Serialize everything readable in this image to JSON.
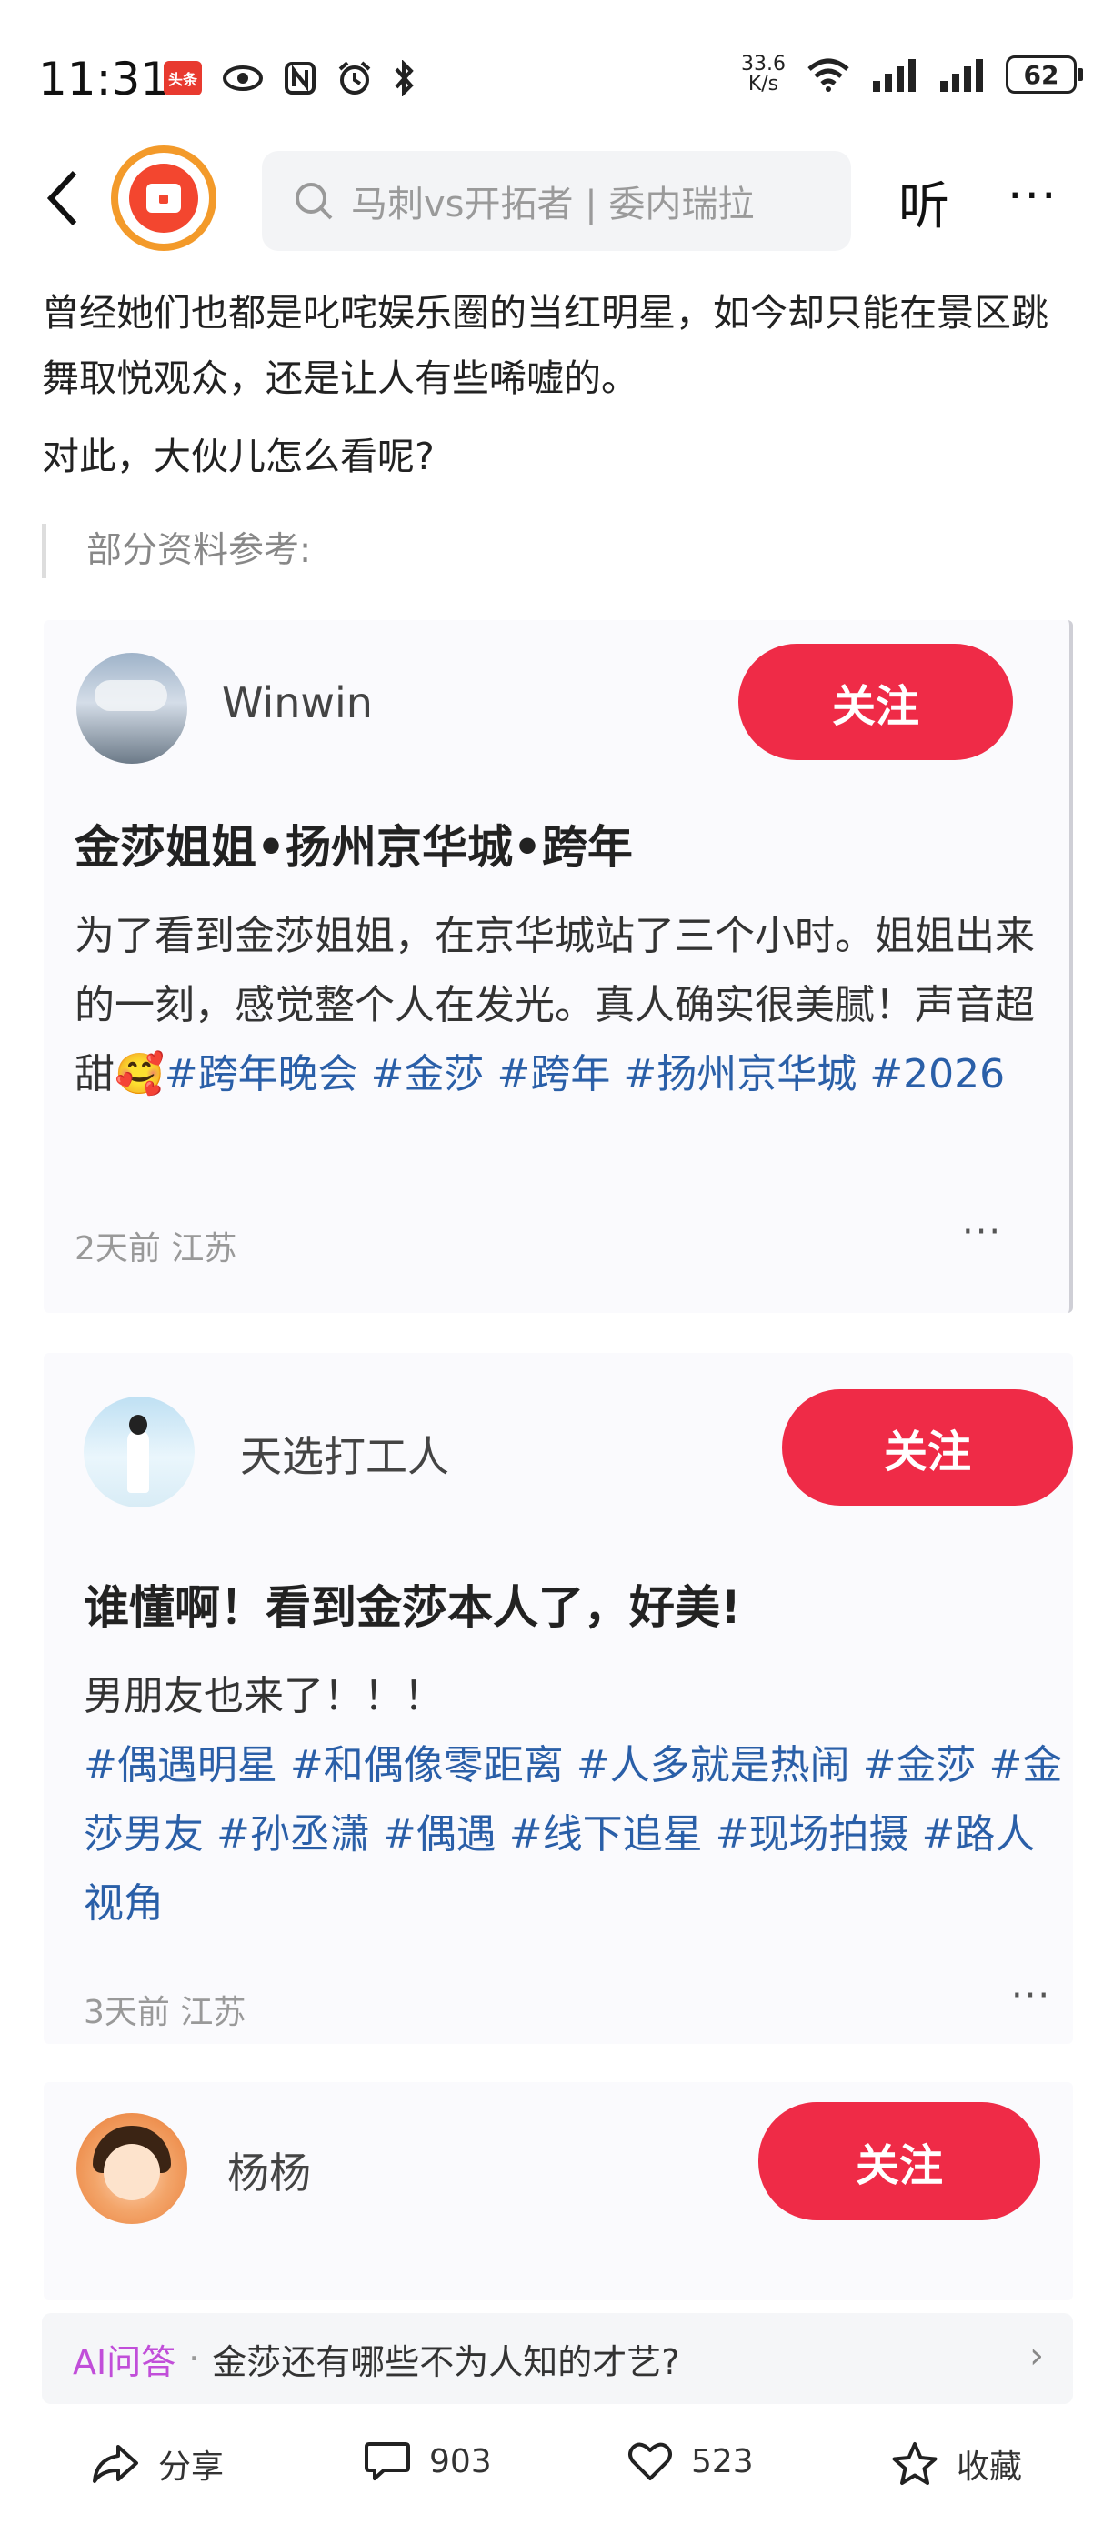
{
  "status_bar": {
    "time": "11:31",
    "news_badge": "头条",
    "net_speed_value": "33.6",
    "net_speed_unit": "K/s",
    "battery": "62"
  },
  "nav": {
    "search_placeholder": "马刺vs开拓者 | 委内瑞拉",
    "listen_label": "听",
    "more_label": "···"
  },
  "article": {
    "paragraph_1": "曾经她们也都是叱咤娱乐圈的当红明星，如今却只能在景区跳舞取悦观众，还是让人有些唏嘘的。",
    "paragraph_2": "对此，大伙儿怎么看呢?",
    "reference_label": "部分资料参考:"
  },
  "posts": [
    {
      "username": "Winwin",
      "follow_label": "关注",
      "title": "金莎姐姐•扬州京华城•跨年",
      "body_text": "为了看到金莎姐姐，在京华城站了三个小时。姐姐出来的一刻，感觉整个人在发光。真人确实很美腻！声音超甜🥰",
      "hashtags": [
        "#跨年晚会",
        "#金莎",
        "#跨年",
        "#扬州京华城",
        "#2026"
      ],
      "meta": "2天前 江苏",
      "more_label": "···"
    },
    {
      "username": "天选打工人",
      "follow_label": "关注",
      "title": "谁懂啊！看到金莎本人了，好美!",
      "body_text": "男朋友也来了！！！",
      "hashtags": [
        "#偶遇明星",
        "#和偶像零距离",
        "#人多就是热闹",
        "#金莎",
        "#金莎男友",
        "#孙丞潇",
        "#偶遇",
        "#线下追星",
        "#现场拍摄",
        "#路人视角"
      ],
      "meta": "3天前 江苏",
      "more_label": "···"
    },
    {
      "username": "杨杨",
      "follow_label": "关注"
    }
  ],
  "ai_bar": {
    "label": "AI问答",
    "dot": "·",
    "question": "金莎还有哪些不为人知的才艺?",
    "chevron": "›"
  },
  "bottom_bar": {
    "share_label": "分享",
    "comment_count": "903",
    "like_count": "523",
    "favorite_label": "收藏"
  },
  "colors": {
    "follow_button": "#ef2b47",
    "hashtag": "#2a5fa8",
    "ai_label": "#c14ed9",
    "logo_ring": "#f39a2a",
    "logo_fill": "#f3462f"
  },
  "icons": [
    "back-arrow-icon",
    "search-icon",
    "eye-icon",
    "nfc-icon",
    "alarm-icon",
    "bluetooth-icon",
    "wifi-icon",
    "signal-icon",
    "share-icon",
    "comment-icon",
    "heart-icon",
    "star-icon",
    "chevron-right-icon"
  ]
}
